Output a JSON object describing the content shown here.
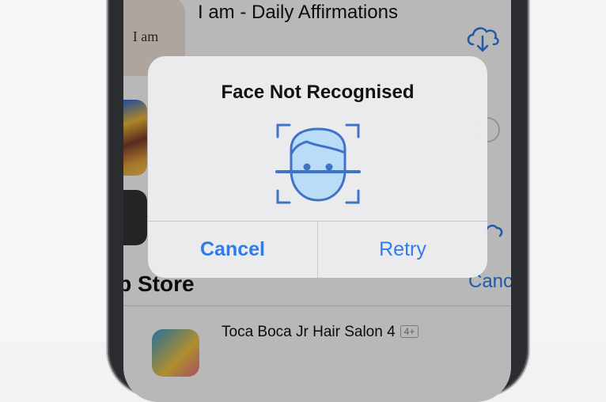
{
  "colors": {
    "accent": "#2f7ce8",
    "face_fill": "#b9dcf7",
    "face_stroke": "#3f73c6"
  },
  "background_apps": {
    "app1": {
      "icon_text": "I am",
      "title": "I am - Daily Affirmations",
      "action_icon": "cloud-download-icon"
    },
    "store_header": "op Store",
    "store_cancel": "Canc",
    "app4": {
      "title": "Toca Boca Jr Hair Salon 4",
      "age_rating": "4+"
    }
  },
  "alert": {
    "title": "Face Not Recognised",
    "icon": "face-id-icon",
    "cancel_label": "Cancel",
    "retry_label": "Retry"
  }
}
